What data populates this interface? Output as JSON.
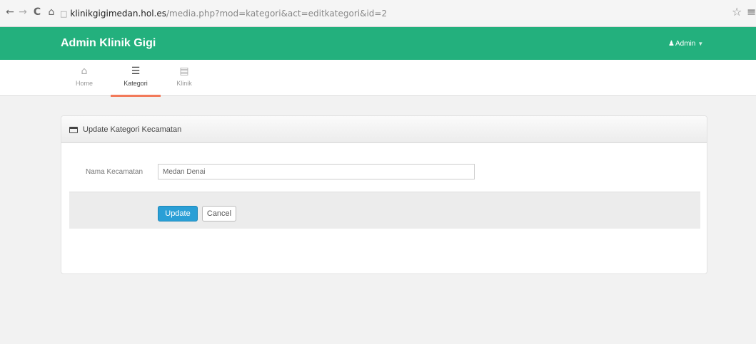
{
  "browser": {
    "url_host": "klinikgigimedan.hol.es",
    "url_path": "/media.php?mod=kategori&act=editkategori&id=2"
  },
  "navbar": {
    "brand": "Admin Klinik Gigi",
    "user_label": "Admin"
  },
  "subnav": {
    "items": [
      {
        "label": "Home",
        "icon": "home-icon"
      },
      {
        "label": "Kategori",
        "icon": "list-icon",
        "active": true
      },
      {
        "label": "Klinik",
        "icon": "table-icon"
      }
    ]
  },
  "widget": {
    "title": "Update Kategori Kecamatan",
    "field_label": "Nama Kecamatan",
    "field_value": "Medan Denai",
    "update_label": "Update",
    "cancel_label": "Cancel"
  },
  "colors": {
    "navbar": "#23b07d",
    "active_tab_underline": "#f27a5a",
    "primary_button": "#2a9fd6"
  }
}
